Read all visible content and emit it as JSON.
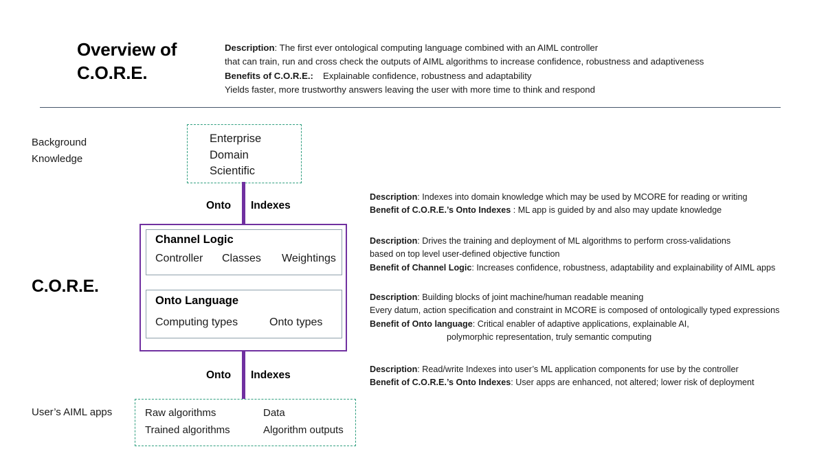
{
  "header": {
    "title_line1": "Overview of",
    "title_line2": "C.O.R.E.",
    "description_label": "Description",
    "description_line1": ": The first ever ontological computing  language  combined with an  AIML controller",
    "description_line2": "that can train, run and cross check the outputs  of AIML algorithms to increase confidence, robustness and adaptiveness",
    "benefits_label": "Benefits of C.O.R.E.:",
    "benefits_line1": "Explainable confidence, robustness and adaptability",
    "benefits_line2": "Yields faster, more trustworthy  answers leaving the user with  more time to think and respond"
  },
  "left_labels": {
    "background_knowledge_line1": "Background",
    "background_knowledge_line2": "Knowledge",
    "core": "C.O.R.E.",
    "user_apps": "User’s AIML apps"
  },
  "knowledge_box": {
    "items": [
      "Enterprise",
      "Domain",
      "Scientific"
    ]
  },
  "connectors": {
    "top_caption_onto": "Onto",
    "top_caption_indexes": "Indexes",
    "bottom_caption_onto": "Onto",
    "bottom_caption_indexes": "Indexes"
  },
  "channel_logic": {
    "heading": "Channel Logic",
    "items": [
      "Controller",
      "Classes",
      "Weightings"
    ]
  },
  "onto_language": {
    "heading": "Onto Language",
    "items": [
      "Computing types",
      "Onto types"
    ]
  },
  "user_apps_box": {
    "rows": [
      [
        "Raw algorithms",
        "Data"
      ],
      [
        "Trained algorithms",
        "Algorithm outputs"
      ]
    ]
  },
  "descriptions": {
    "onto_indexes_top": {
      "description_label": "Description",
      "description_text": ": Indexes into domain  knowledge which may be used by MCORE for reading or writing",
      "benefit_label": "Benefit of C.O.R.E.’s Onto Indexes",
      "benefit_text": " : ML app is guided by and also may update knowledge"
    },
    "channel_logic": {
      "description_label": "Description",
      "description_text": ":  Drives the training and deployment  of ML algorithms to  perform  cross-validations",
      "description_line2": "based on  top  level user-defined objective  function",
      "benefit_label": "Benefit of Channel Logic",
      "benefit_text": ": Increases confidence, robustness, adaptability and explainability of AIML apps"
    },
    "onto_language": {
      "description_label": "Description",
      "description_text": ":  Building blocks of joint machine/human  readable meaning",
      "description_line2": "Every datum,  action specification and constraint in MCORE is composed of ontologically typed expressions",
      "benefit_label": "Benefit of Onto language",
      "benefit_text": ":  Critical enabler of adaptive applications, explainable AI,",
      "benefit_line2": "polymorphic  representation, truly semantic computing"
    },
    "onto_indexes_bottom": {
      "description_label": "Description",
      "description_text": ": Read/write Indexes into  user’s ML application components  for use by the controller",
      "benefit_label": "Benefit of C.O.R.E.’s Onto Indexes",
      "benefit_text": ": User apps are enhanced, not altered; lower risk of deployment"
    }
  },
  "colors": {
    "purple": "#7030A0",
    "teal_dashed": "#2E9E7E",
    "divider_blue": "#44546A",
    "inner_border": "#8EA0AB"
  }
}
